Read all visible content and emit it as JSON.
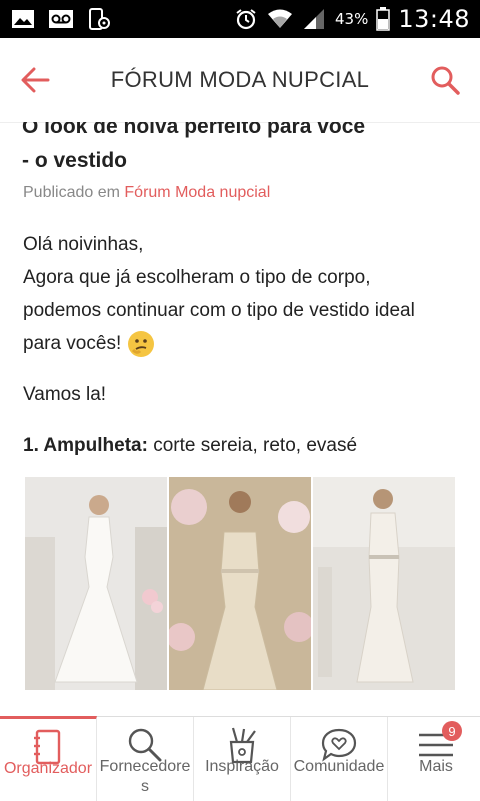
{
  "status_bar": {
    "battery_percent": "43%",
    "time": "13:48",
    "icons": [
      "image-icon",
      "voicemail-icon",
      "phone-settings-icon",
      "alarm-icon",
      "wifi-icon",
      "signal-icon",
      "battery-icon"
    ]
  },
  "appbar": {
    "title": "FÓRUM MODA NUPCIAL",
    "back_icon": "arrow-left-icon",
    "search_icon": "search-icon",
    "accent": "#e25d5d"
  },
  "post": {
    "title_partial": "O look de noiva perfeito para você",
    "title_line2": "- o vestido",
    "meta_prefix": "Publicado em",
    "meta_link": "Fórum Moda nupcial",
    "body_line1": "Olá noivinhas,",
    "body_line2": "Agora que já escolheram o tipo de corpo,",
    "body_line3": "podemos continuar com o tipo de vestido ideal",
    "body_line4": "para vocês!",
    "emoji": "thinking-face-emoji",
    "body_line5": "Vamos la!",
    "section_heading": "1. Ampulheta:",
    "section_text": " corte sereia, reto, evasé"
  },
  "bottom_nav": {
    "items": [
      {
        "label": "Organizador",
        "icon": "notebook-icon",
        "active": true
      },
      {
        "label": "Fornecedores",
        "icon": "search-icon"
      },
      {
        "label": "Inspiração",
        "icon": "pencil-cup-icon"
      },
      {
        "label": "Comunidade",
        "icon": "heart-chat-icon"
      },
      {
        "label": "Mais",
        "icon": "menu-icon",
        "badge": "9"
      }
    ]
  }
}
